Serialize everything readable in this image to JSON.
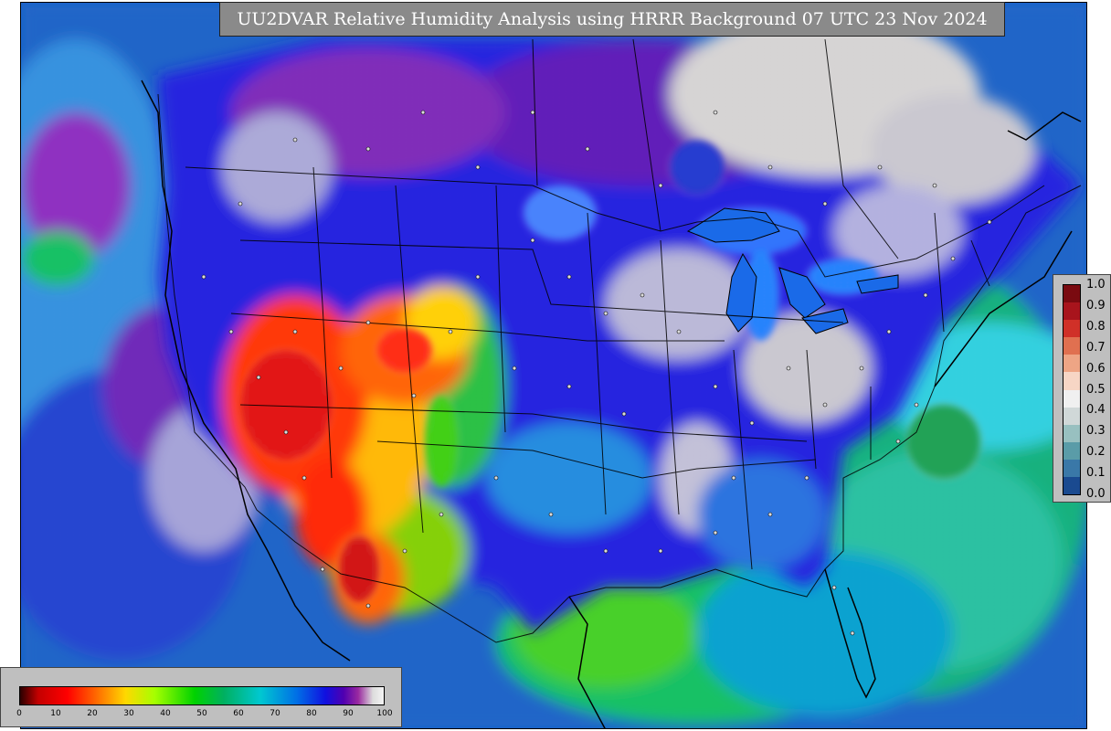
{
  "title": "UU2DVAR Relative Humidity Analysis using HRRR Background 07 UTC 23 Nov 2024",
  "legend": {
    "labels": [
      "1.0",
      "0.9",
      "0.8",
      "0.7",
      "0.6",
      "0.5",
      "0.4",
      "0.3",
      "0.2",
      "0.1",
      "0.0"
    ],
    "colors": [
      "#7a0a10",
      "#a8141c",
      "#d03028",
      "#e07050",
      "#eea585",
      "#f7d6c5",
      "#f0f0f0",
      "#d0d8d8",
      "#98c0c0",
      "#5a9ca8",
      "#3a78a8",
      "#1a4a90"
    ]
  },
  "colorbar": {
    "ticks": [
      "0",
      "10",
      "20",
      "30",
      "40",
      "50",
      "60",
      "70",
      "80",
      "90",
      "100"
    ]
  },
  "colors": {
    "ocean_deep": "#1560c8",
    "gulf_green": "#00b060",
    "dry_red": "#ff0000",
    "moist_purple": "#5000b0",
    "saturated_gray": "#d2d2d2"
  }
}
